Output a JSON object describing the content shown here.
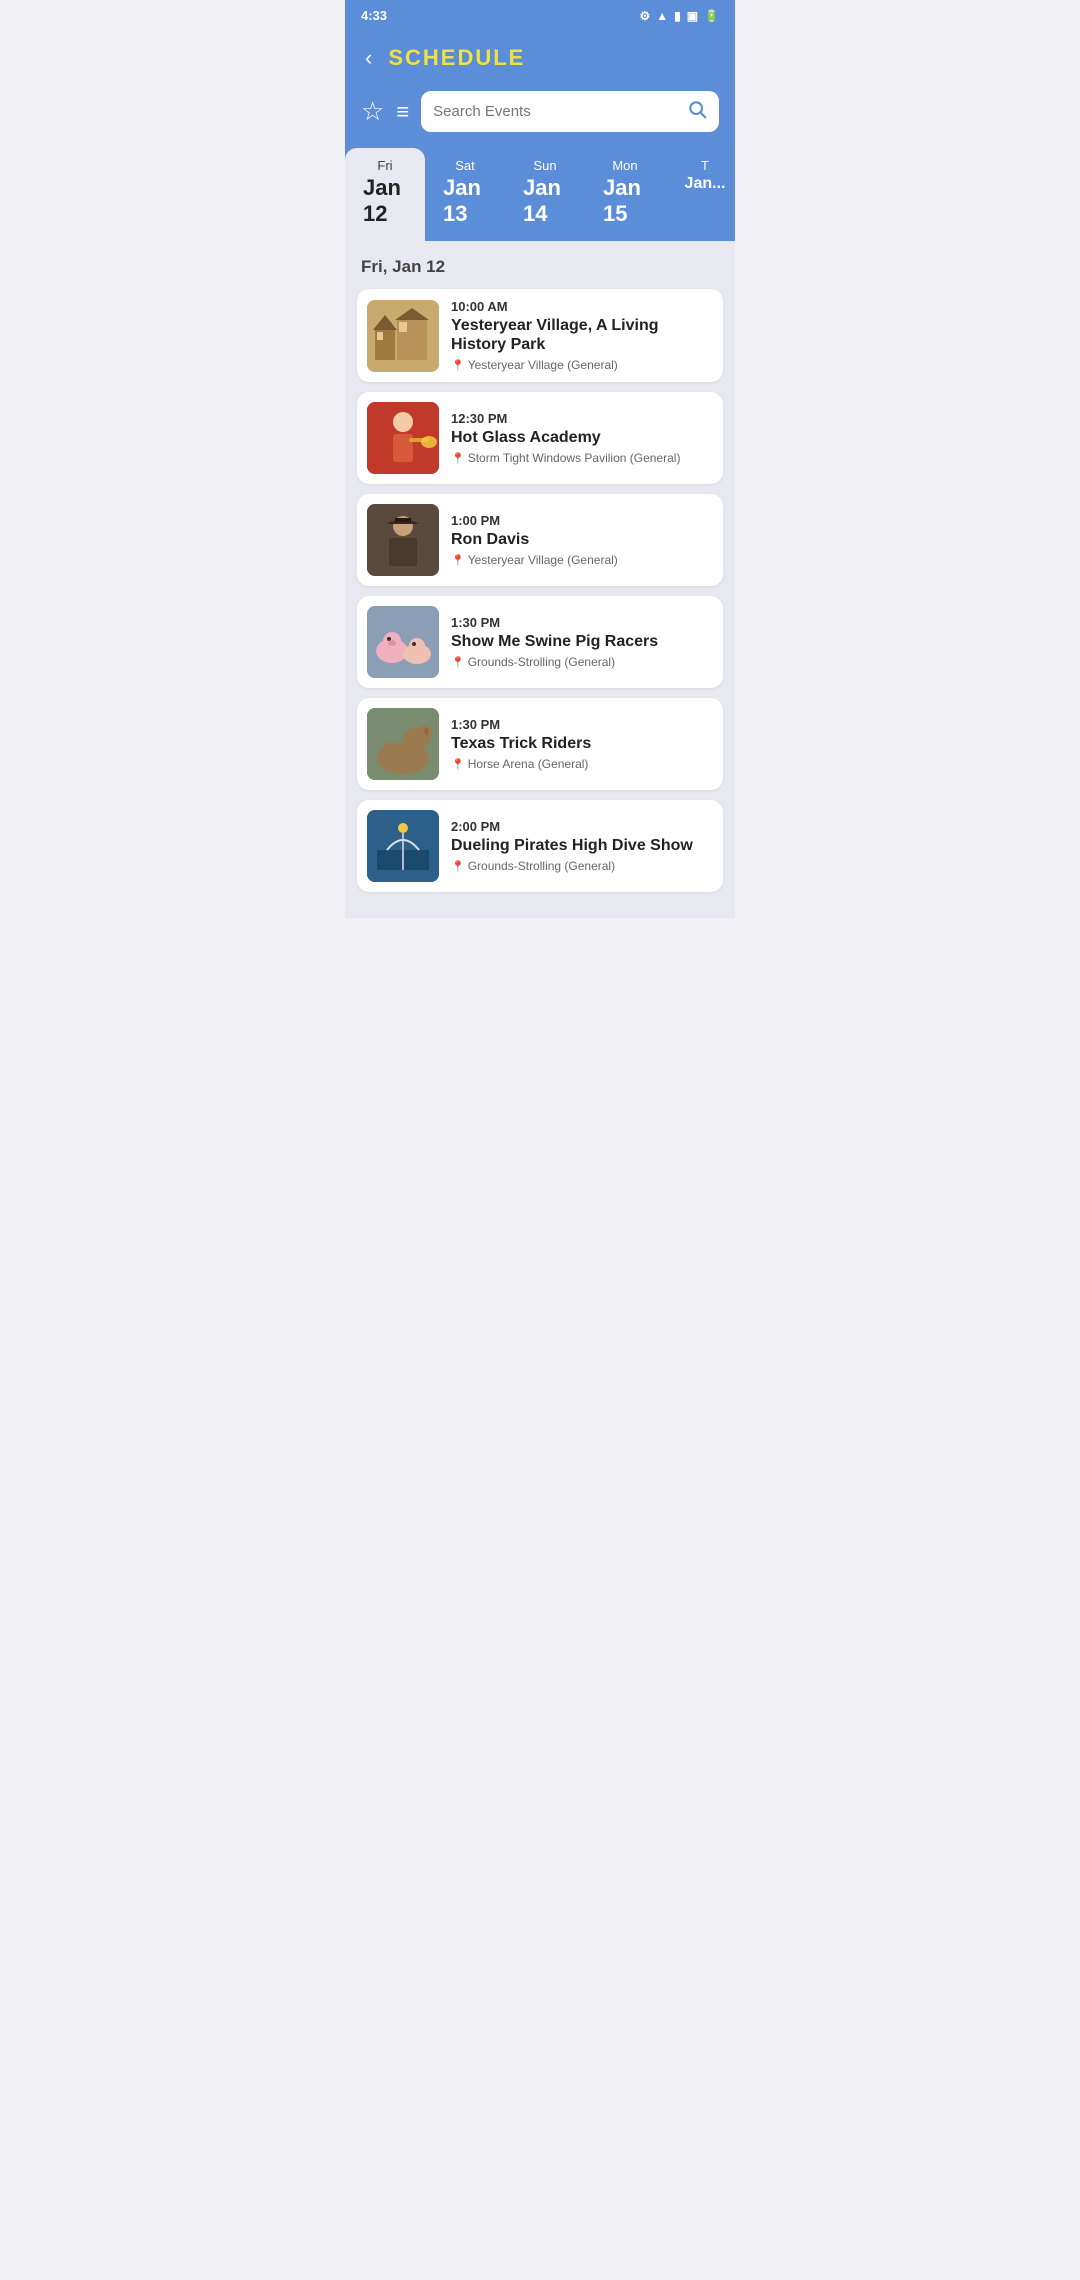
{
  "statusBar": {
    "time": "4:33",
    "icons": [
      "settings",
      "wifi",
      "battery"
    ]
  },
  "header": {
    "title": "SCHEDULE",
    "backLabel": "‹"
  },
  "search": {
    "placeholder": "Search Events"
  },
  "dayTabs": [
    {
      "id": "fri-jan12",
      "dayName": "Fri",
      "dayNum": "Jan 12",
      "active": true
    },
    {
      "id": "sat-jan13",
      "dayName": "Sat",
      "dayNum": "Jan 13",
      "active": false
    },
    {
      "id": "sun-jan14",
      "dayName": "Sun",
      "dayNum": "Jan 14",
      "active": false
    },
    {
      "id": "mon-jan15",
      "dayName": "Mon",
      "dayNum": "Jan 15",
      "active": false
    },
    {
      "id": "tue-jan16",
      "dayName": "T",
      "dayNum": "Jan...",
      "active": false
    }
  ],
  "sectionDate": "Fri, Jan 12",
  "events": [
    {
      "id": "event-1",
      "time": "10:00 AM",
      "name": "Yesteryear Village, A Living History Park",
      "location": "Yesteryear Village (General)",
      "thumbClass": "thumb-1"
    },
    {
      "id": "event-2",
      "time": "12:30 PM",
      "name": "Hot Glass Academy",
      "location": "Storm Tight Windows Pavilion (General)",
      "thumbClass": "thumb-2"
    },
    {
      "id": "event-3",
      "time": "1:00 PM",
      "name": "Ron Davis",
      "location": "Yesteryear Village (General)",
      "thumbClass": "thumb-3"
    },
    {
      "id": "event-4",
      "time": "1:30 PM",
      "name": "Show Me Swine Pig Racers",
      "location": "Grounds-Strolling (General)",
      "thumbClass": "thumb-4"
    },
    {
      "id": "event-5",
      "time": "1:30 PM",
      "name": "Texas Trick Riders",
      "location": "Horse Arena (General)",
      "thumbClass": "thumb-5"
    },
    {
      "id": "event-6",
      "time": "2:00 PM",
      "name": "Dueling Pirates High Dive Show",
      "location": "Grounds-Strolling (General)",
      "thumbClass": "thumb-6"
    }
  ],
  "icons": {
    "back": "‹",
    "star": "☆",
    "filter": "≡",
    "search": "🔍",
    "location": "📍"
  }
}
